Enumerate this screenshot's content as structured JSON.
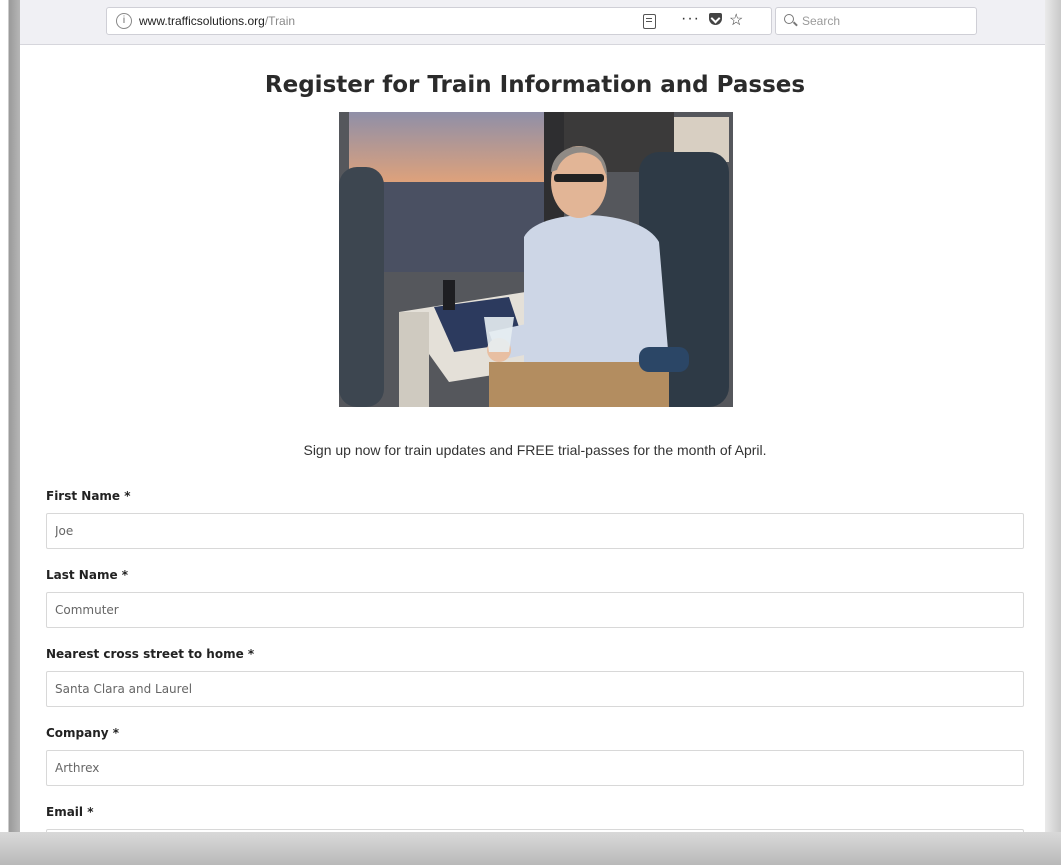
{
  "browser": {
    "url_domain": "www.trafficsolutions.org",
    "url_path": "/Train",
    "search_placeholder": "Search",
    "more_label": "···",
    "star_label": "☆",
    "info_label": "i"
  },
  "page": {
    "title": "Register for Train Information and Passes",
    "intro": "Sign up now for train updates and FREE trial-passes for the month of April.",
    "form": {
      "first_name": {
        "label": "First Name *",
        "value": "Joe"
      },
      "last_name": {
        "label": "Last Name *",
        "value": "Commuter"
      },
      "cross_street": {
        "label": "Nearest cross street to home *",
        "value": "Santa Clara and Laurel"
      },
      "company": {
        "label": "Company *",
        "value": "Arthrex"
      },
      "email": {
        "label": "Email *",
        "value": ""
      }
    }
  },
  "icons": {
    "info": "info-icon",
    "reader": "reader-view-icon",
    "more": "more-icon",
    "pocket": "pocket-icon",
    "bookmark": "star-icon",
    "search": "search-icon"
  }
}
